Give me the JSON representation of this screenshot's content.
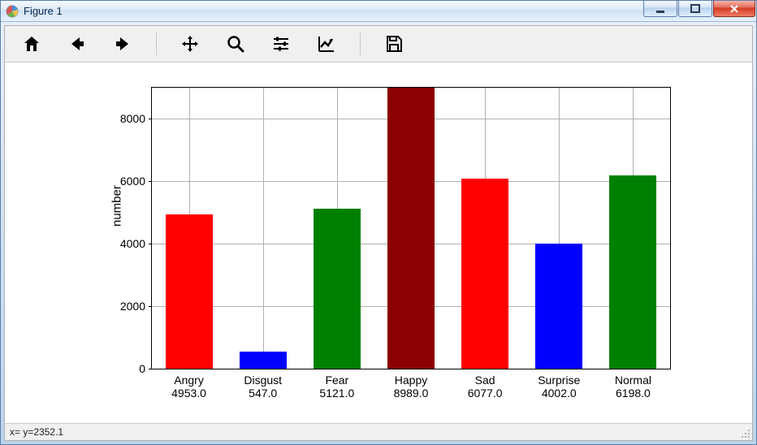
{
  "window": {
    "title": "Figure 1"
  },
  "toolbar": {
    "home": "Home",
    "back": "Back",
    "forward": "Forward",
    "pan": "Pan",
    "zoom": "Zoom",
    "config": "Configure subplots",
    "axes_edit": "Edit axes",
    "save": "Save"
  },
  "statusbar": {
    "coord": "x= y=2352.1"
  },
  "chart_data": {
    "type": "bar",
    "categories": [
      "Angry",
      "Disgust",
      "Fear",
      "Happy",
      "Sad",
      "Surprise",
      "Normal"
    ],
    "values": [
      4953.0,
      547.0,
      5121.0,
      8989.0,
      6077.0,
      4002.0,
      6198.0
    ],
    "colors": [
      "#ff0000",
      "#0000ff",
      "#008000",
      "#8b0000",
      "#ff0000",
      "#0000ff",
      "#008000"
    ],
    "xlabel": "",
    "ylabel": "number",
    "title": "",
    "ylim": [
      0,
      9000
    ],
    "yticks": [
      0,
      2000,
      4000,
      6000,
      8000
    ]
  }
}
